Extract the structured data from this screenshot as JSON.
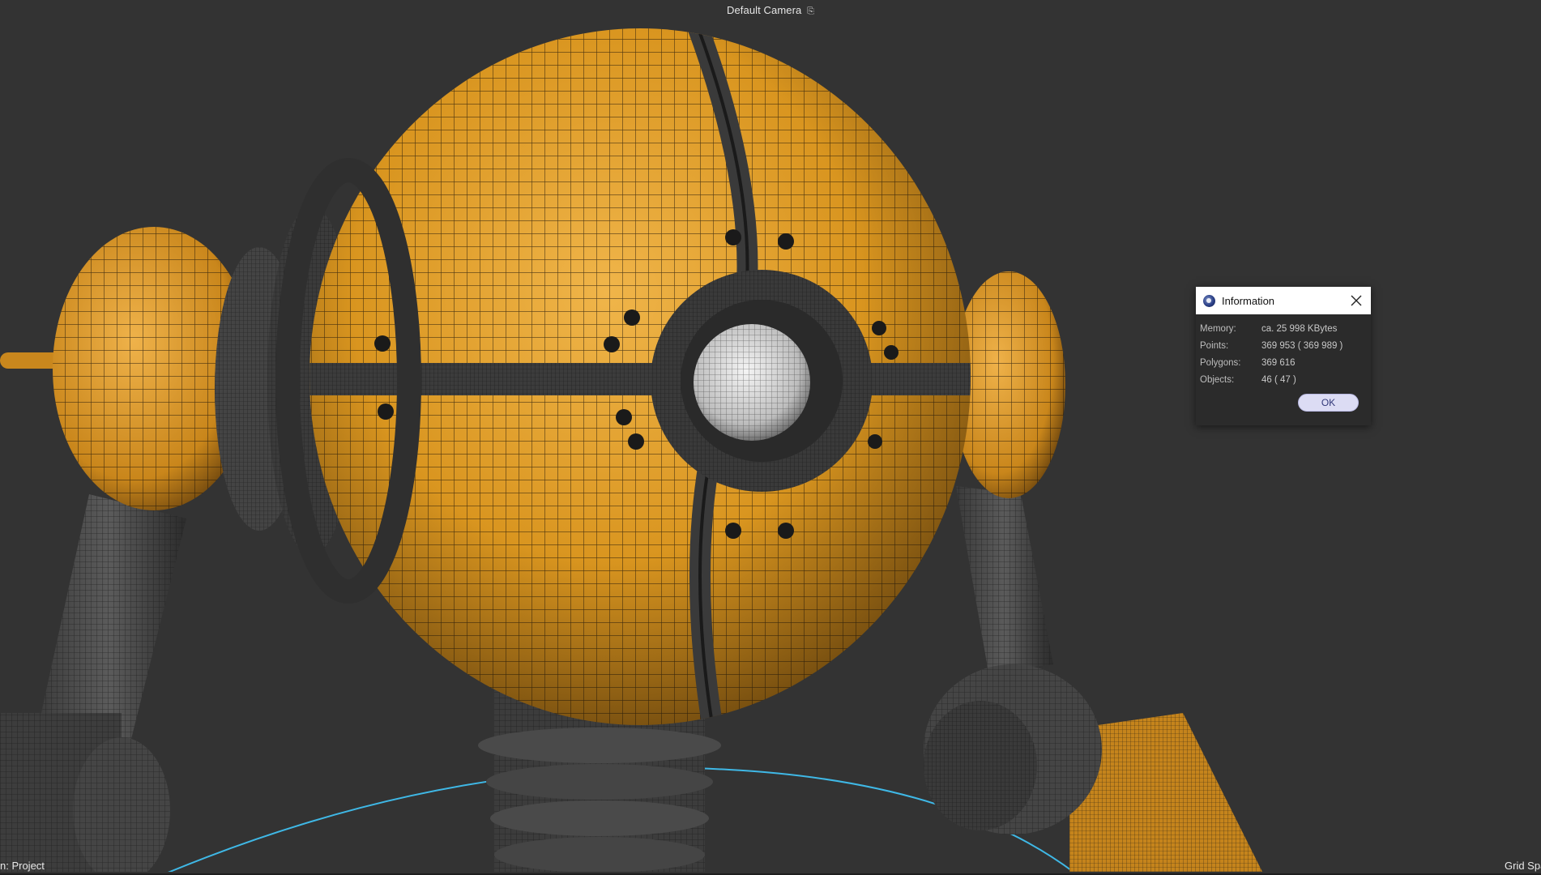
{
  "viewport": {
    "camera_name": "Default Camera",
    "camera_icon": "camera-link-icon",
    "status_left": "n: Project",
    "status_right": "Grid Spa"
  },
  "dialog": {
    "title": "Information",
    "app_icon": "cinema4d-logo-icon",
    "close_icon": "close-icon",
    "rows": [
      {
        "label": "Memory:",
        "value": "ca. 25 998 KBytes"
      },
      {
        "label": "Points:",
        "value": "369 953 ( 369 989 )"
      },
      {
        "label": "Polygons:",
        "value": "369 616"
      },
      {
        "label": "Objects:",
        "value": "46 ( 47 )"
      }
    ],
    "ok_label": "OK"
  },
  "colors": {
    "background": "#333333",
    "robot_orange": "#d9951f",
    "wire_gray": "#4a4a4a",
    "grid_circle": "#3fb8e6"
  }
}
